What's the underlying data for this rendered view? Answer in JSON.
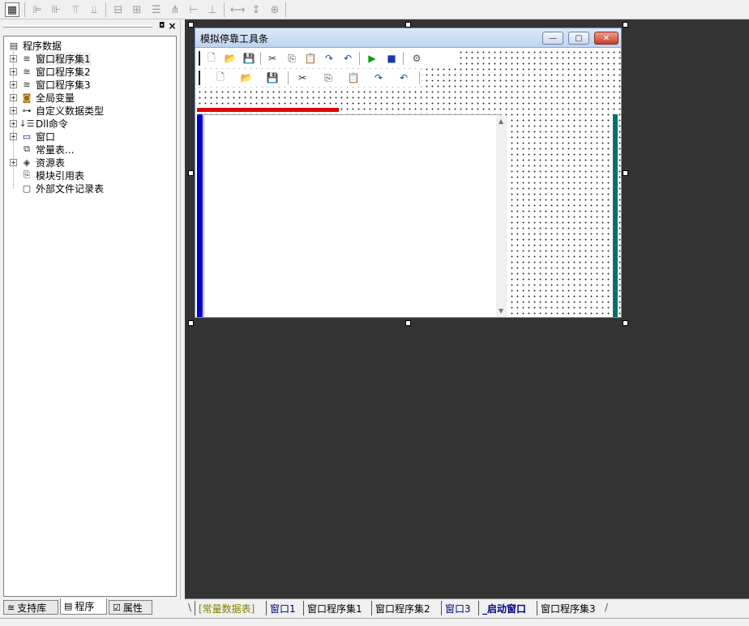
{
  "layout_toolbar": {
    "buttons": [
      {
        "icon": "form-icon"
      },
      {
        "icon": "align-left-icon"
      },
      {
        "icon": "align-right-icon"
      },
      {
        "icon": "align-top-icon"
      },
      {
        "icon": "align-bottom-icon"
      },
      {
        "icon": "center-horizontal-icon"
      },
      {
        "icon": "center-vertical-icon"
      },
      {
        "icon": "distribute-top-icon"
      },
      {
        "icon": "distribute-left-icon"
      },
      {
        "icon": "space-horizontal-icon"
      },
      {
        "icon": "space-vertical-icon"
      },
      {
        "icon": "same-width-icon"
      },
      {
        "icon": "same-height-icon"
      },
      {
        "icon": "same-size-icon"
      }
    ]
  },
  "left_panel": {
    "pin_glyph": "◘",
    "close_glyph": "×",
    "tree": {
      "root": "程序数据",
      "items": [
        {
          "label": "窗口程序集1",
          "expandable": true,
          "icon": "module-icon"
        },
        {
          "label": "窗口程序集2",
          "expandable": true,
          "icon": "module-icon"
        },
        {
          "label": "窗口程序集3",
          "expandable": true,
          "icon": "module-icon"
        },
        {
          "label": "全局变量",
          "expandable": true,
          "icon": "global-variable-icon"
        },
        {
          "label": "自定义数据类型",
          "expandable": true,
          "icon": "custom-type-icon"
        },
        {
          "label": "Dll命令",
          "expandable": true,
          "icon": "dll-icon"
        },
        {
          "label": "窗口",
          "expandable": true,
          "icon": "window-icon"
        },
        {
          "label": "常量表...",
          "expandable": false,
          "icon": "constant-table-icon"
        },
        {
          "label": "资源表",
          "expandable": true,
          "icon": "resource-icon"
        },
        {
          "label": "模块引用表",
          "expandable": false,
          "icon": "module-ref-icon"
        },
        {
          "label": "外部文件记录表",
          "expandable": false,
          "icon": "external-file-icon"
        }
      ]
    },
    "tabs": [
      {
        "label": "支持库",
        "icon": "library-icon",
        "selected": false
      },
      {
        "label": "程序",
        "icon": "program-icon",
        "selected": true
      },
      {
        "label": "属性",
        "icon": "property-icon",
        "selected": false
      }
    ]
  },
  "designer": {
    "form": {
      "title": "模拟停靠工具条",
      "min_glyph": "—",
      "max_glyph": "▢",
      "close_glyph": "✕"
    },
    "toolbar1_icons": [
      "new-icon",
      "open-icon",
      "save-icon",
      "cut-icon",
      "copy-icon",
      "paste-icon",
      "redo-icon",
      "undo-icon",
      "run-icon",
      "stop-icon",
      "tool-icon"
    ],
    "toolbar2_icons": [
      "new-icon",
      "open-icon",
      "save-icon",
      "cut-icon",
      "copy-icon",
      "paste-icon",
      "redo-icon",
      "undo-icon"
    ]
  },
  "bottom_tabs": [
    {
      "label": "[常量数据表]",
      "active": false,
      "color": "#808000"
    },
    {
      "label": "窗口1",
      "active": false,
      "color": "#000080"
    },
    {
      "label": "窗口程序集1",
      "active": false,
      "color": "#000000"
    },
    {
      "label": "窗口程序集2",
      "active": false,
      "color": "#000000"
    },
    {
      "label": "窗口3",
      "active": false,
      "color": "#000080"
    },
    {
      "label": "_启动窗口",
      "active": true,
      "color": "#000080"
    },
    {
      "label": "窗口程序集3",
      "active": false,
      "color": "#000000"
    }
  ]
}
